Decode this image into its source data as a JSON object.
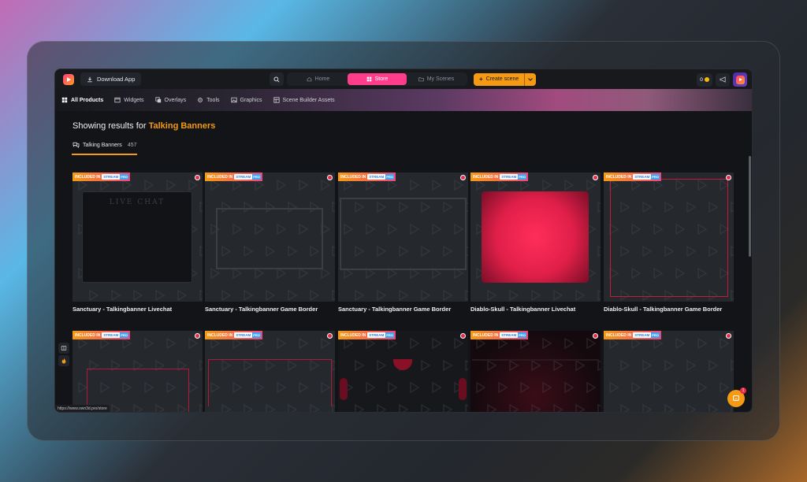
{
  "topbar": {
    "download_label": "Download App",
    "nav": [
      {
        "label": "Home",
        "icon": "home-icon"
      },
      {
        "label": "Store",
        "icon": "store-grid-icon"
      },
      {
        "label": "My Scenes",
        "icon": "folder-icon"
      }
    ],
    "create_label": "Create scene",
    "coins": "0"
  },
  "subnav": [
    {
      "label": "All Products",
      "icon": "grid-icon"
    },
    {
      "label": "Widgets",
      "icon": "widget-icon"
    },
    {
      "label": "Overlays",
      "icon": "overlay-icon"
    },
    {
      "label": "Tools",
      "icon": "tools-icon"
    },
    {
      "label": "Graphics",
      "icon": "image-icon"
    },
    {
      "label": "Scene Builder Assets",
      "icon": "assets-icon"
    }
  ],
  "results": {
    "prefix": "Showing results for",
    "query": "Talking Banners",
    "tab_label": "Talking Banners",
    "tab_count": "457"
  },
  "badge": {
    "text": "INCLUDED IN",
    "pro_a": "STREAM",
    "pro_b": "PRO"
  },
  "cards_row1": [
    {
      "title": "Sanctuary - Talkingbanner Livechat",
      "livechat_text": "LIVE CHAT"
    },
    {
      "title": "Sanctuary - Talkingbanner Game Border"
    },
    {
      "title": "Sanctuary - Talkingbanner Game Border"
    },
    {
      "title": "Diablo-Skull - Talkingbanner Livechat"
    },
    {
      "title": "Diablo-Skull - Talkingbanner Game Border"
    }
  ],
  "status_url": "https://www.own3d.pro/store",
  "chat_badge": "1",
  "colors": {
    "accent_orange": "#f59a12",
    "accent_pink": "#ff3d8b",
    "red": "#e01f48"
  }
}
